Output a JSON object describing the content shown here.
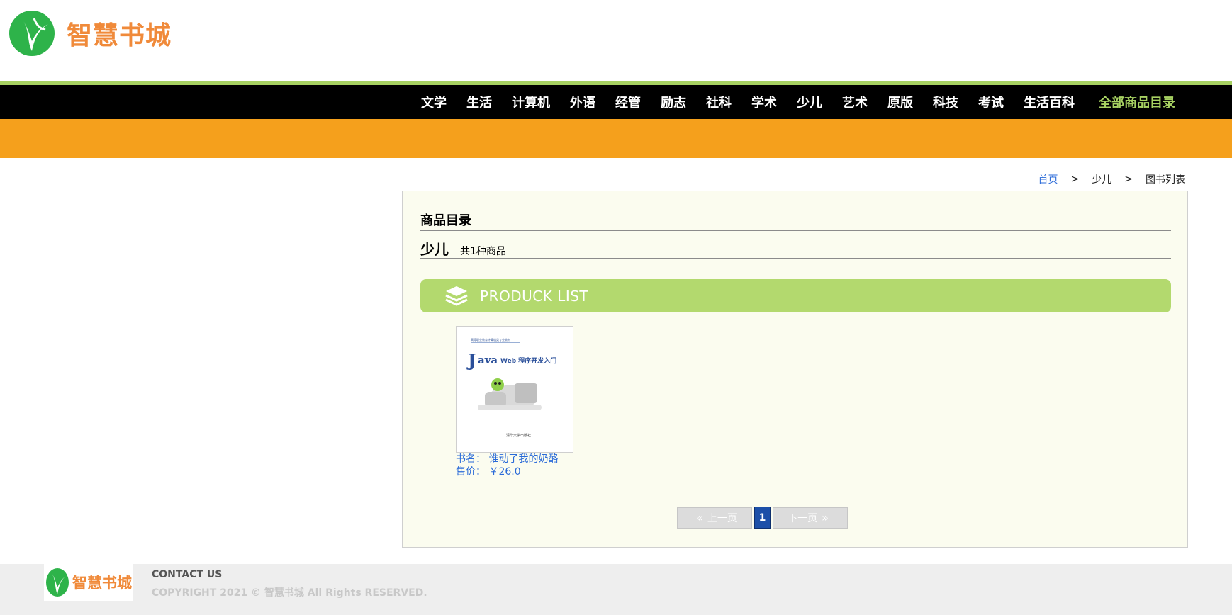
{
  "header": {
    "logo_text": "智慧书城"
  },
  "nav": {
    "items": [
      {
        "label": "文学"
      },
      {
        "label": "生活"
      },
      {
        "label": "计算机"
      },
      {
        "label": "外语"
      },
      {
        "label": "经管"
      },
      {
        "label": "励志"
      },
      {
        "label": "社科"
      },
      {
        "label": "学术"
      },
      {
        "label": "少儿"
      },
      {
        "label": "艺术"
      },
      {
        "label": "原版"
      },
      {
        "label": "科技"
      },
      {
        "label": "考试"
      },
      {
        "label": "生活百科"
      }
    ],
    "all_label": "全部商品目录"
  },
  "breadcrumb": {
    "home": "首页",
    "sep1": ">",
    "category": "少儿",
    "sep2": ">",
    "current": "图书列表"
  },
  "panel": {
    "title": "商品目录",
    "category_name": "少儿",
    "count_text": "共1种商品",
    "banner_text": "PRODUCK LIST"
  },
  "products": [
    {
      "cover_title": "Java Web 程序开发入门",
      "cover_top_text": "高等职业教育计算机类专业教材",
      "cover_bottom_text": "清华大学出版社",
      "name_label": "书名：",
      "name": "谁动了我的奶酪",
      "price_label": "售价：",
      "price": "￥26.0"
    }
  ],
  "pagination": {
    "prev": "上一页",
    "current": "1",
    "next": "下一页"
  },
  "footer": {
    "logo_text": "智慧书城",
    "contact": "CONTACT US",
    "copyright": "COPYRIGHT 2021 © 智慧书城 All Rights RESERVED."
  },
  "colors": {
    "accent_green": "#a7d162",
    "banner_green": "#b3d96e",
    "orange": "#f5a01c",
    "logo_orange": "#f08a3a",
    "link_blue": "#2a6ad8",
    "pager_blue": "#1c4fa8"
  }
}
